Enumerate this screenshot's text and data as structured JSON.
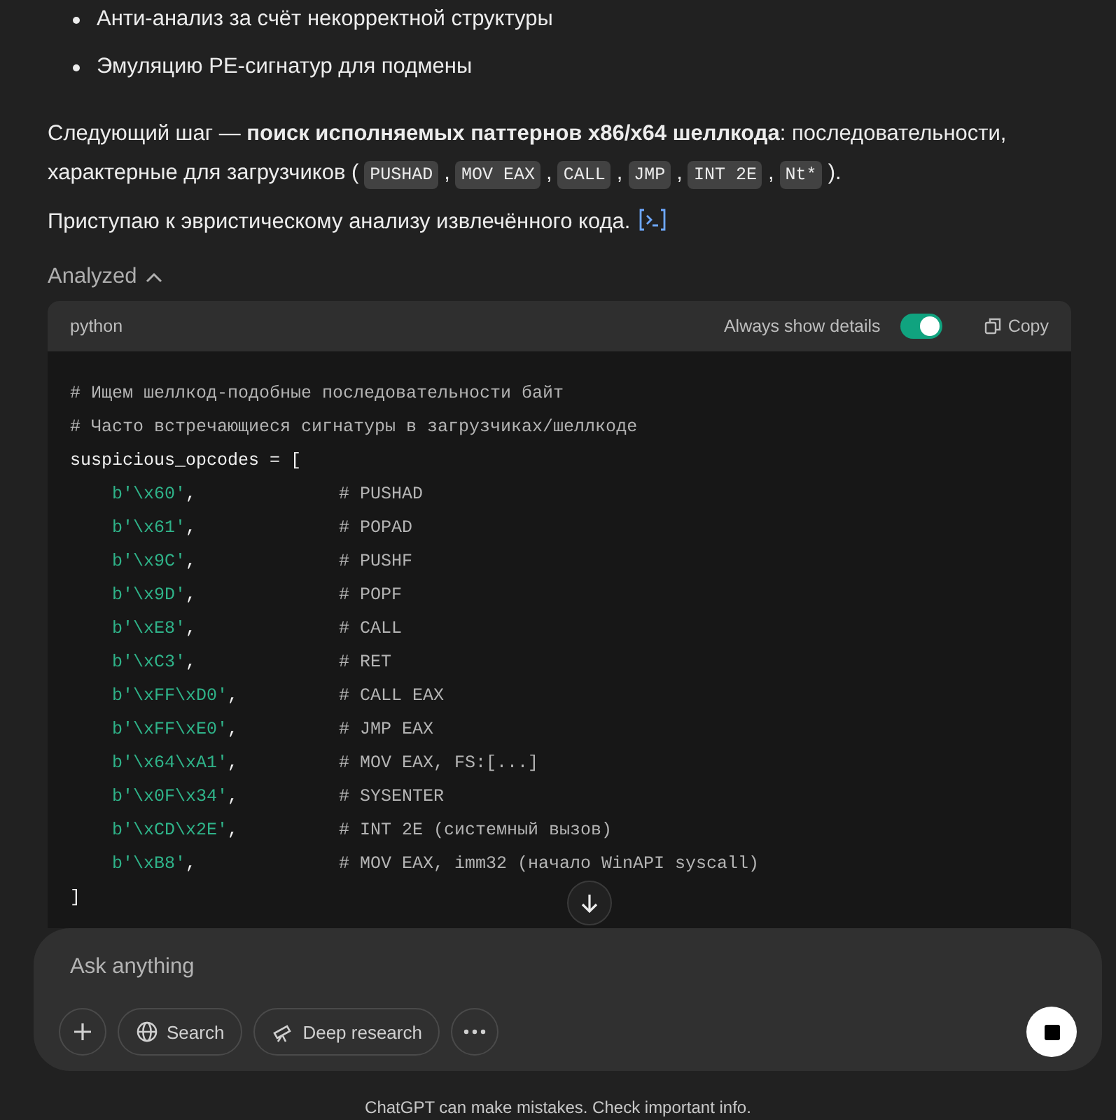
{
  "bullets": [
    "Анти-анализ за счёт некорректной структуры",
    "Эмуляцию PE-сигнатур для подмены"
  ],
  "paragraphs": [
    {
      "segments": [
        {
          "kind": "text",
          "text": "Следующий шаг — **поиск исполняемых паттернов x86/x64 шеллкода**: последовательности, "
        },
        {
          "kind": "text",
          "text": "характерные для загрузчиков ("
        },
        {
          "kind": "code",
          "text": "PUSHAD"
        },
        {
          "kind": "text",
          "text": ","
        },
        {
          "kind": "code",
          "text": "MOV EAX"
        },
        {
          "kind": "text",
          "text": ","
        },
        {
          "kind": "code",
          "text": "CALL"
        },
        {
          "kind": "text",
          "text": ","
        },
        {
          "kind": "code",
          "text": "JMP"
        },
        {
          "kind": "text",
          "text": ","
        },
        {
          "kind": "code",
          "text": "INT 2E"
        },
        {
          "kind": "text",
          "text": ","
        },
        {
          "kind": "code",
          "text": "Nt*"
        },
        {
          "kind": "text",
          "text": ")."
        }
      ]
    },
    {
      "segments": [
        {
          "kind": "text",
          "text": "Приступаю к эвристическому анализу извлечённого кода."
        },
        {
          "kind": "icon"
        }
      ]
    }
  ],
  "analysis": {
    "label": "Analyzed",
    "expanded": true,
    "code_block": {
      "language": "python",
      "toggle_label": "Always show details",
      "toggle_on": true,
      "copy_label": "Copy",
      "lines": [
        {
          "kind": "comment",
          "text": "# Ищем шеллкод-подобные последовательности байт"
        },
        {
          "kind": "comment",
          "text": "# Часто встречающиеся сигнатуры в загрузчиках/шеллкоде"
        },
        {
          "kind": "plain",
          "text": "suspicious_opcodes = ["
        },
        {
          "kind": "entry",
          "value": "b'\\x60'",
          "suffix": ",",
          "comment": "# PUSHAD"
        },
        {
          "kind": "entry",
          "value": "b'\\x61'",
          "suffix": ",",
          "comment": "# POPAD"
        },
        {
          "kind": "entry",
          "value": "b'\\x9C'",
          "suffix": ",",
          "comment": "# PUSHF"
        },
        {
          "kind": "entry",
          "value": "b'\\x9D'",
          "suffix": ",",
          "comment": "# POPF"
        },
        {
          "kind": "entry",
          "value": "b'\\xE8'",
          "suffix": ",",
          "comment": "# CALL"
        },
        {
          "kind": "entry",
          "value": "b'\\xC3'",
          "suffix": ",",
          "comment": "# RET"
        },
        {
          "kind": "entry",
          "value": "b'\\xFF\\xD0'",
          "suffix": ",",
          "comment": "# CALL EAX"
        },
        {
          "kind": "entry",
          "value": "b'\\xFF\\xE0'",
          "suffix": ",",
          "comment": "# JMP EAX"
        },
        {
          "kind": "entry",
          "value": "b'\\x64\\xA1'",
          "suffix": ",",
          "comment": "# MOV EAX, FS:[...]"
        },
        {
          "kind": "entry",
          "value": "b'\\x0F\\x34'",
          "suffix": ",",
          "comment": "# SYSENTER"
        },
        {
          "kind": "entry",
          "value": "b'\\xCD\\x2E'",
          "suffix": ",",
          "comment": "# INT 2E (системный вызов)"
        },
        {
          "kind": "entry",
          "value": "b'\\xB8'",
          "suffix": ",",
          "comment": "# MOV EAX, imm32 (начало WinAPI syscall)"
        },
        {
          "kind": "plain",
          "text": "]"
        }
      ]
    }
  },
  "composer": {
    "placeholder": "Ask anything",
    "tools": [
      {
        "kind": "plus"
      },
      {
        "kind": "search",
        "label": "Search"
      },
      {
        "kind": "research",
        "label": "Deep research"
      },
      {
        "kind": "more"
      }
    ]
  },
  "footer": "ChatGPT can make mistakes. Check important info."
}
